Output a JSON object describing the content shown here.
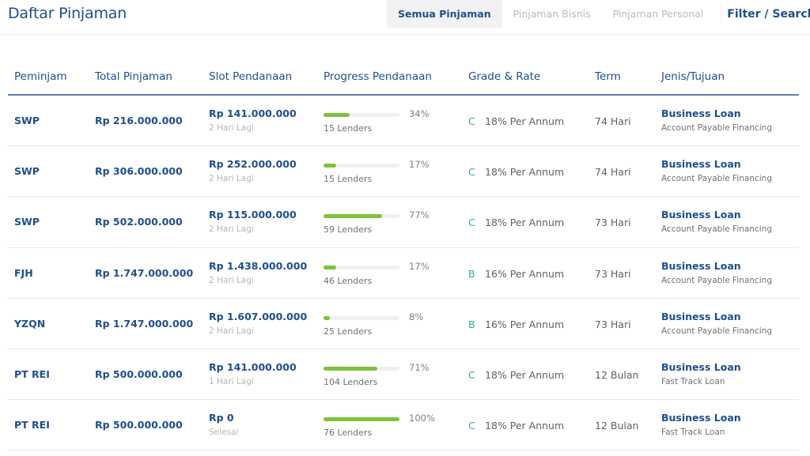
{
  "header": {
    "title": "Daftar Pinjaman",
    "tabs": [
      {
        "label": "Semua Pinjaman",
        "active": true
      },
      {
        "label": "Pinjaman Bisnis",
        "active": false
      },
      {
        "label": "Pinjaman Personal",
        "active": false
      }
    ],
    "filter_label": "Filter / Search"
  },
  "table": {
    "columns": [
      "Peminjam",
      "Total Pinjaman",
      "Slot Pendanaan",
      "Progress Pendanaan",
      "Grade & Rate",
      "Term",
      "Jenis/Tujuan"
    ],
    "rows": [
      {
        "borrower": "SWP",
        "total": "Rp 216.000.000",
        "slot_amount": "Rp 141.000.000",
        "slot_status": "2 Hari Lagi",
        "progress": 34,
        "progress_label": "34%",
        "lenders": "15 Lenders",
        "grade": "C",
        "rate": "18% Per Annum",
        "term": "74 Hari",
        "type": "Business Loan",
        "purpose": "Account Payable Financing"
      },
      {
        "borrower": "SWP",
        "total": "Rp 306.000.000",
        "slot_amount": "Rp 252.000.000",
        "slot_status": "2 Hari Lagi",
        "progress": 17,
        "progress_label": "17%",
        "lenders": "15 Lenders",
        "grade": "C",
        "rate": "18% Per Annum",
        "term": "74 Hari",
        "type": "Business Loan",
        "purpose": "Account Payable Financing"
      },
      {
        "borrower": "SWP",
        "total": "Rp 502.000.000",
        "slot_amount": "Rp 115.000.000",
        "slot_status": "2 Hari Lagi",
        "progress": 77,
        "progress_label": "77%",
        "lenders": "59 Lenders",
        "grade": "C",
        "rate": "18% Per Annum",
        "term": "73 Hari",
        "type": "Business Loan",
        "purpose": "Account Payable Financing"
      },
      {
        "borrower": "FJH",
        "total": "Rp 1.747.000.000",
        "slot_amount": "Rp 1.438.000.000",
        "slot_status": "2 Hari Lagi",
        "progress": 17,
        "progress_label": "17%",
        "lenders": "46 Lenders",
        "grade": "B",
        "rate": "16% Per Annum",
        "term": "73 Hari",
        "type": "Business Loan",
        "purpose": "Account Payable Financing"
      },
      {
        "borrower": "YZQN",
        "total": "Rp 1.747.000.000",
        "slot_amount": "Rp 1.607.000.000",
        "slot_status": "2 Hari Lagi",
        "progress": 8,
        "progress_label": "8%",
        "lenders": "25 Lenders",
        "grade": "B",
        "rate": "16% Per Annum",
        "term": "73 Hari",
        "type": "Business Loan",
        "purpose": "Account Payable Financing"
      },
      {
        "borrower": "PT REI",
        "total": "Rp 500.000.000",
        "slot_amount": "Rp 141.000.000",
        "slot_status": "1 Hari Lagi",
        "progress": 71,
        "progress_label": "71%",
        "lenders": "104 Lenders",
        "grade": "C",
        "rate": "18% Per Annum",
        "term": "12 Bulan",
        "type": "Business Loan",
        "purpose": "Fast Track Loan"
      },
      {
        "borrower": "PT REI",
        "total": "Rp 500.000.000",
        "slot_amount": "Rp 0",
        "slot_status": "Selesai",
        "progress": 100,
        "progress_label": "100%",
        "lenders": "76 Lenders",
        "grade": "C",
        "rate": "18% Per Annum",
        "term": "12 Bulan",
        "type": "Business Loan",
        "purpose": "Fast Track Loan"
      }
    ]
  },
  "colors": {
    "primary": "#1f4e8c",
    "progress": "#7cc33c",
    "grade": "#34b36e"
  }
}
